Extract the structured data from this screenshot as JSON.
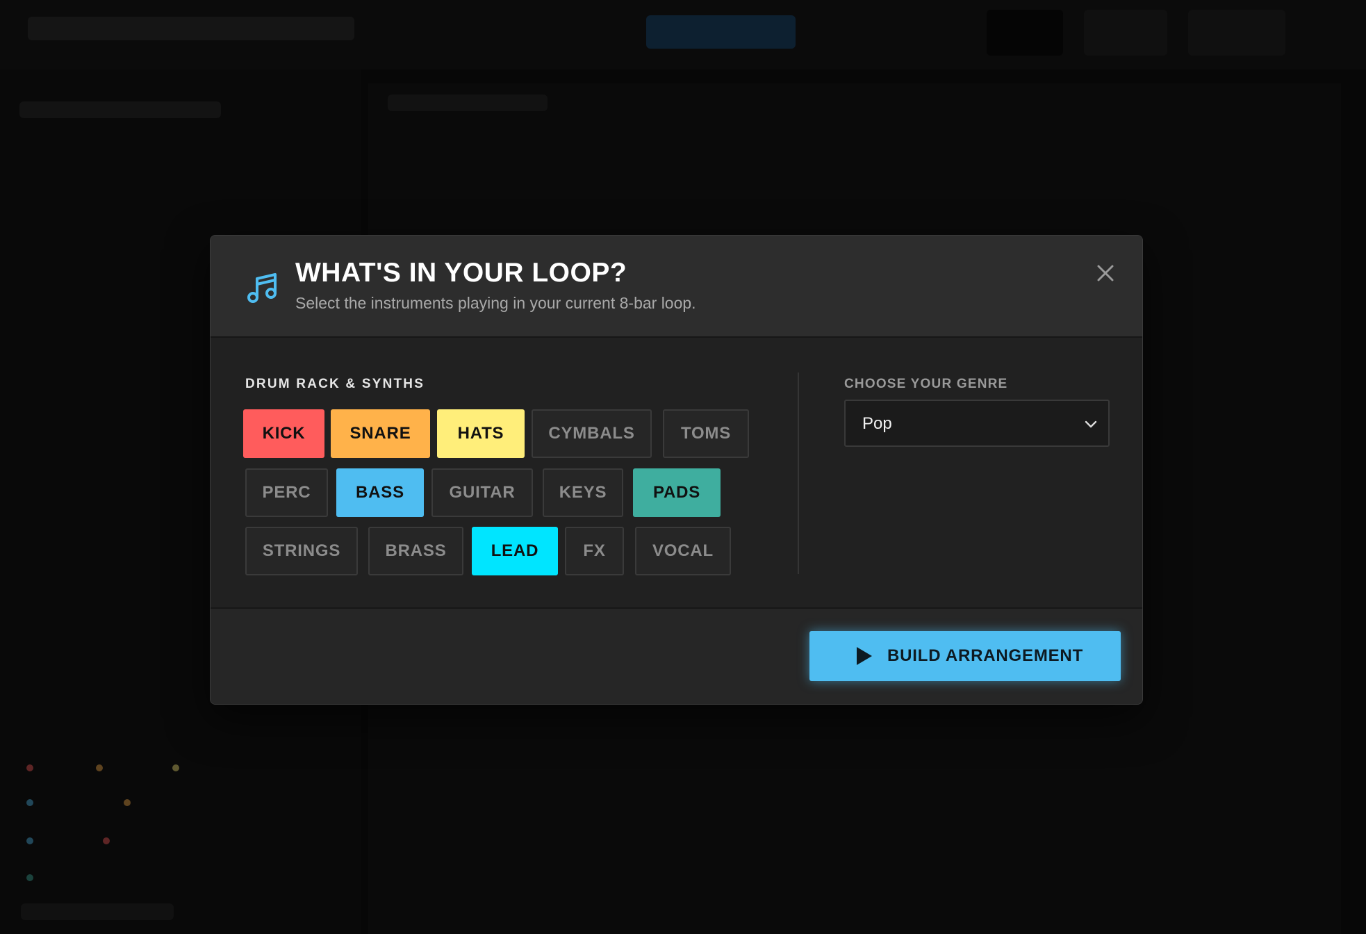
{
  "modal": {
    "title": "WHAT'S IN YOUR LOOP?",
    "subtitle": "Select the instruments playing in your current 8-bar loop.",
    "icon": "music-note-icon",
    "close_icon": "close-icon"
  },
  "drum_section": {
    "label": "DRUM RACK & SYNTHS",
    "instruments": [
      {
        "label": "KICK",
        "selected": true,
        "color": "#ff5c5c"
      },
      {
        "label": "SNARE",
        "selected": true,
        "color": "#ffb24a"
      },
      {
        "label": "HATS",
        "selected": true,
        "color": "#ffee7a"
      },
      {
        "label": "CYMBALS",
        "selected": false
      },
      {
        "label": "TOMS",
        "selected": false
      },
      {
        "label": "PERC",
        "selected": false
      },
      {
        "label": "BASS",
        "selected": true,
        "color": "#4fbdf1"
      },
      {
        "label": "GUITAR",
        "selected": false
      },
      {
        "label": "KEYS",
        "selected": false
      },
      {
        "label": "PADS",
        "selected": true,
        "color": "#3fae9f"
      },
      {
        "label": "STRINGS",
        "selected": false
      },
      {
        "label": "BRASS",
        "selected": false
      },
      {
        "label": "LEAD",
        "selected": true,
        "color": "#00e5ff"
      },
      {
        "label": "FX",
        "selected": false
      },
      {
        "label": "VOCAL",
        "selected": false
      }
    ]
  },
  "genre": {
    "label": "CHOOSE YOUR GENRE",
    "selected": "Pop"
  },
  "footer": {
    "build_label": "BUILD ARRANGEMENT",
    "build_icon": "play-icon",
    "accent": "#4fbdf1"
  }
}
